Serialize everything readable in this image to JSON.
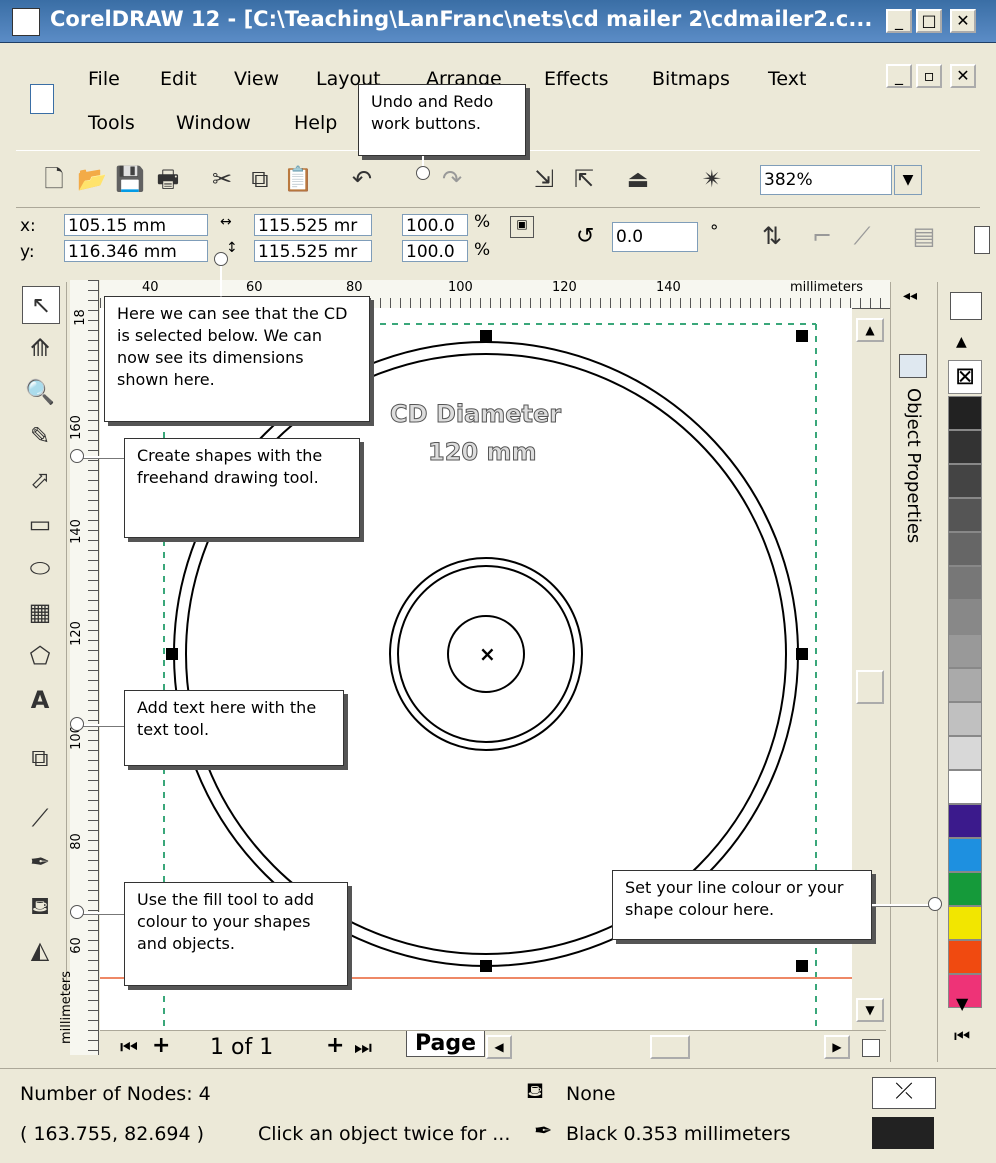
{
  "window": {
    "title": "CorelDRAW 12 - [C:\\Teaching\\LanFranc\\nets\\cd mailer 2\\cdmailer2.c..."
  },
  "menu": {
    "row1": [
      "File",
      "Edit",
      "View",
      "Layout",
      "Arrange",
      "Effects",
      "Bitmaps",
      "Text"
    ],
    "row2": [
      "Tools",
      "Window",
      "Help"
    ]
  },
  "toolbar": {
    "zoom": "382%"
  },
  "propbar": {
    "x_label": "x:",
    "x_value": "105.15 mm",
    "y_label": "y:",
    "y_value": "116.346 mm",
    "w_value": "115.525 mr",
    "h_value": "115.525 mr",
    "scale_x": "100.0",
    "scale_y": "100.0",
    "pct": "%",
    "rotation": "0.0",
    "deg": "°"
  },
  "ruler": {
    "top_ticks": [
      "40",
      "60",
      "80",
      "100",
      "120",
      "140"
    ],
    "top_unit": "millimeters",
    "left_ticks": [
      "18",
      "160",
      "140",
      "120",
      "100",
      "80",
      "60"
    ],
    "left_unit": "millimeters"
  },
  "canvas": {
    "label_line1": "CD Diameter",
    "label_line2": "120 mm"
  },
  "docker": {
    "label": "Object Properties"
  },
  "palette": {
    "colors": [
      "#222222",
      "#333333",
      "#444444",
      "#555555",
      "#666666",
      "#777777",
      "#888888",
      "#999999",
      "#aaaaaa",
      "#c0c0c0",
      "#d8d8d8",
      "#ffffff",
      "#3b1a8c",
      "#1e90e0",
      "#159a3a",
      "#f2e600",
      "#f04a10",
      "#ee3377"
    ]
  },
  "pagebar": {
    "counter": "1 of 1",
    "tab": "Page"
  },
  "status": {
    "nodes": "Number of Nodes: 4",
    "coords": "( 163.755, 82.694 )",
    "hint": "Click an object twice for ...",
    "fill": "None",
    "outline": "Black  0.353 millimeters"
  },
  "callouts": {
    "undo": "Undo and Redo work buttons.",
    "selected": "Here we can see that the CD is selected below. We can now see its dimensions shown here.",
    "freehand": "Create shapes with the freehand drawing tool.",
    "text": "Add text here with the text tool.",
    "fill": "Use the fill tool to add colour to your shapes and objects.",
    "colour": "Set your line colour or your shape colour here."
  }
}
